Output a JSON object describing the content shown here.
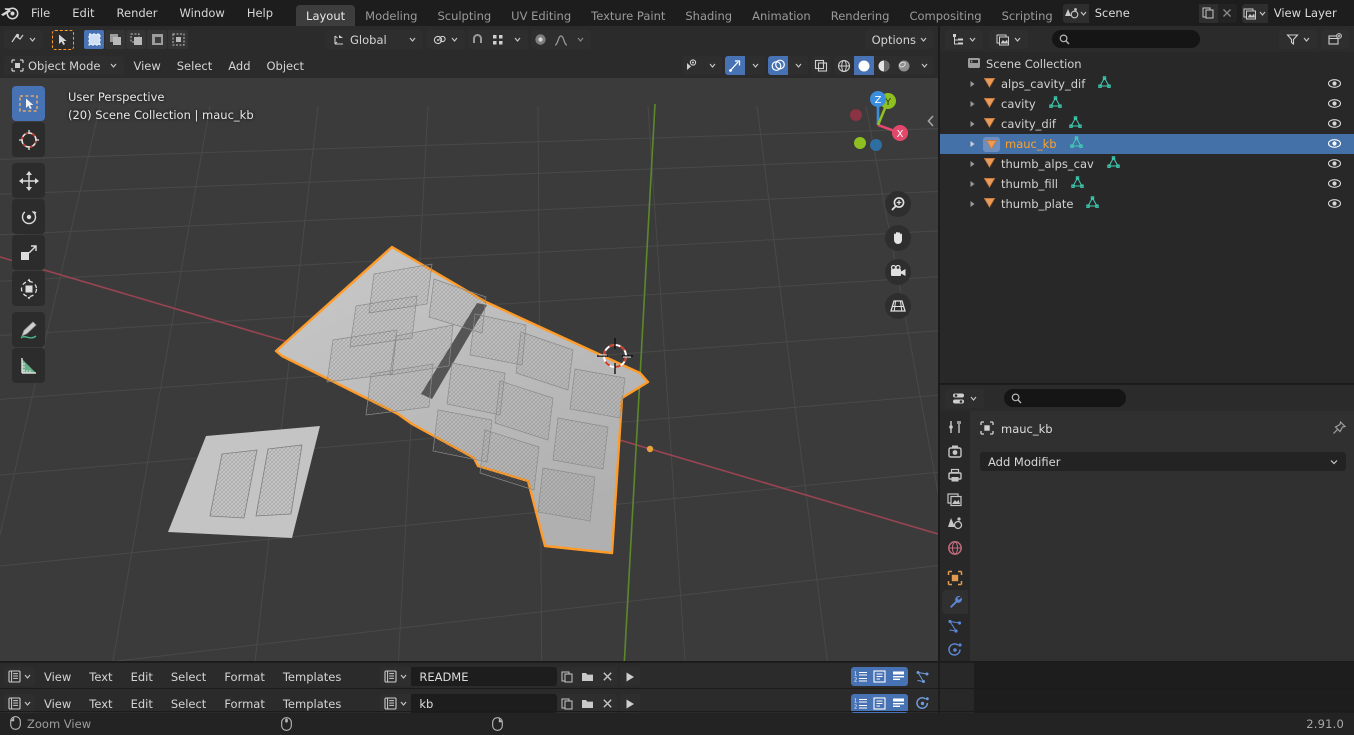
{
  "app": {
    "name": "Blender",
    "version": "2.91.0",
    "logo_icon": "blender-logo-icon"
  },
  "topbar": {
    "menus": [
      "File",
      "Edit",
      "Render",
      "Window",
      "Help"
    ],
    "workspace_tabs": [
      {
        "label": "Layout",
        "active": true
      },
      {
        "label": "Modeling",
        "active": false
      },
      {
        "label": "Sculpting",
        "active": false
      },
      {
        "label": "UV Editing",
        "active": false
      },
      {
        "label": "Texture Paint",
        "active": false
      },
      {
        "label": "Shading",
        "active": false
      },
      {
        "label": "Animation",
        "active": false
      },
      {
        "label": "Rendering",
        "active": false
      },
      {
        "label": "Compositing",
        "active": false
      },
      {
        "label": "Scripting",
        "active": false
      }
    ],
    "scene": {
      "label": "Scene",
      "icon": "scene-icon",
      "new_icon": "duplicate-icon",
      "unlink_icon": "close-x-icon"
    },
    "view_layer": {
      "label": "View Layer",
      "icon": "view-layer-icon",
      "new_icon": "duplicate-icon",
      "unlink_icon": "close-x-icon"
    }
  },
  "viewport": {
    "header": {
      "editor_type_icon": "editor-type-3dview-icon",
      "mode": "Object Mode",
      "mode_icon": "object-mode-icon",
      "menus": [
        "View",
        "Select",
        "Add",
        "Object"
      ],
      "select_modes": [
        "select-box-icon",
        "select-new-icon",
        "select-extend-icon",
        "select-subtract-icon",
        "select-invert-icon"
      ],
      "cursor_tool_icon": "cursor-tool-icon",
      "transform_orientation": "Global",
      "transform_orientation_icon": "orientation-global-icon",
      "pivot_icon": "pivot-point-icon",
      "snap_icon": "snap-magnet-icon",
      "snap_target_icon": "snap-target-icon",
      "proportional_icon": "proportional-editing-icon",
      "proportional_falloff_icon": "falloff-smooth-icon",
      "options_label": "Options",
      "visibility_icon": "visibility-eye-icon",
      "gizmo_icon": "gizmo-icon",
      "overlays_icon": "overlays-icon",
      "xray_icon": "xray-toggle-icon",
      "shading_modes": [
        {
          "icon": "shading-wireframe-icon",
          "active": false
        },
        {
          "icon": "shading-solid-icon",
          "active": true
        },
        {
          "icon": "shading-material-icon",
          "active": false
        },
        {
          "icon": "shading-rendered-icon",
          "active": false
        }
      ]
    },
    "overlay": {
      "perspective": "User Perspective",
      "context": "(20) Scene Collection | mauc_kb"
    },
    "toolbar": [
      {
        "name": "tweak-select-box-tool",
        "icon": "select-box-tool-icon",
        "active": true
      },
      {
        "name": "cursor-tool",
        "icon": "3d-cursor-tool-icon",
        "active": false
      },
      {
        "name": "move-tool",
        "icon": "move-tool-icon",
        "active": false
      },
      {
        "name": "rotate-tool",
        "icon": "rotate-tool-icon",
        "active": false
      },
      {
        "name": "scale-tool",
        "icon": "scale-tool-icon",
        "active": false
      },
      {
        "name": "transform-tool",
        "icon": "transform-tool-icon",
        "active": false
      },
      {
        "name": "annotate-tool",
        "icon": "annotate-tool-icon",
        "active": false
      },
      {
        "name": "measure-tool",
        "icon": "measure-tool-icon",
        "active": false
      }
    ],
    "gizmo": {
      "axes": [
        "X",
        "Y",
        "Z"
      ],
      "colors": {
        "x": "#e2486a",
        "y": "#8fc022",
        "z": "#3b8ede"
      }
    },
    "nav_buttons": [
      "zoom-icon",
      "pan-hand-icon",
      "camera-view-icon",
      "toggle-ortho-grid-icon"
    ],
    "sidebar_toggle_icon": "chevron-left-icon",
    "cursor_3d_icon": "3d-cursor-icon",
    "scene_objects": [
      {
        "name": "mauc_kb",
        "selected": true,
        "description": "split keyboard plate with key cutouts"
      },
      {
        "name": "thumb_plate",
        "selected": false,
        "description": "small two-key thumb cluster plate"
      }
    ]
  },
  "outliner": {
    "header": {
      "editor_type_icon": "editor-type-outliner-icon",
      "display_mode_icon": "outliner-view-layer-icon",
      "search_icon": "search-icon",
      "search_value": "",
      "filter_icon": "filter-funnel-icon",
      "new_collection_icon": "new-collection-icon"
    },
    "root": {
      "label": "Scene Collection",
      "icon": "collection-icon"
    },
    "items": [
      {
        "label": "alps_cavity_dif",
        "icon": "object-mesh-icon",
        "data_icon": "mesh-data-icon",
        "selected": false,
        "visible": true
      },
      {
        "label": "cavity",
        "icon": "object-mesh-icon",
        "data_icon": "mesh-data-icon",
        "selected": false,
        "visible": true
      },
      {
        "label": "cavity_dif",
        "icon": "object-mesh-icon",
        "data_icon": "mesh-data-icon",
        "selected": false,
        "visible": true
      },
      {
        "label": "mauc_kb",
        "icon": "object-mesh-icon",
        "data_icon": "mesh-data-icon",
        "selected": true,
        "visible": true
      },
      {
        "label": "thumb_alps_cav",
        "icon": "object-mesh-icon",
        "data_icon": "mesh-data-icon",
        "selected": false,
        "visible": true
      },
      {
        "label": "thumb_fill",
        "icon": "object-mesh-icon",
        "data_icon": "mesh-data-icon",
        "selected": false,
        "visible": true
      },
      {
        "label": "thumb_plate",
        "icon": "object-mesh-icon",
        "data_icon": "mesh-data-icon",
        "selected": false,
        "visible": true
      }
    ]
  },
  "properties": {
    "header": {
      "editor_type_icon": "editor-type-properties-icon",
      "search_icon": "search-icon",
      "search_value": ""
    },
    "tabs": [
      {
        "name": "tool",
        "icon": "tool-wrench-screwdriver-icon",
        "active": false
      },
      {
        "name": "render",
        "icon": "render-camera-icon",
        "active": false
      },
      {
        "name": "output",
        "icon": "output-printer-icon",
        "active": false
      },
      {
        "name": "view-layer",
        "icon": "view-layer-images-icon",
        "active": false
      },
      {
        "name": "scene",
        "icon": "scene-cone-icon",
        "active": false
      },
      {
        "name": "world",
        "icon": "world-globe-icon",
        "active": false
      },
      {
        "name": "object",
        "icon": "object-square-icon",
        "active": false
      },
      {
        "name": "modifier",
        "icon": "modifier-wrench-icon",
        "active": true
      },
      {
        "name": "particles",
        "icon": "particles-icon",
        "active": false
      },
      {
        "name": "physics",
        "icon": "physics-orbit-icon",
        "active": false
      }
    ],
    "breadcrumb": {
      "object_icon": "object-data-icon",
      "object_name": "mauc_kb",
      "pin_icon": "pin-icon"
    },
    "add_modifier": {
      "label": "Add Modifier",
      "chevron_icon": "chevron-down-icon"
    }
  },
  "text_editors": [
    {
      "editor_type_icon": "editor-type-text-icon",
      "menus": [
        "View",
        "Text",
        "Edit",
        "Select",
        "Format",
        "Templates"
      ],
      "datablock_icon": "text-datablock-icon",
      "filename": "README",
      "new_icon": "duplicate-icon",
      "open_icon": "folder-open-icon",
      "unlink_icon": "close-x-icon",
      "run_icon": "run-script-icon",
      "toggles": [
        "line-numbers-icon",
        "word-wrap-icon",
        "syntax-highlight-icon"
      ],
      "side_icon": "particles-icon"
    },
    {
      "editor_type_icon": "editor-type-text-icon",
      "menus": [
        "View",
        "Text",
        "Edit",
        "Select",
        "Format",
        "Templates"
      ],
      "datablock_icon": "text-datablock-icon",
      "filename": "kb",
      "new_icon": "duplicate-icon",
      "open_icon": "folder-open-icon",
      "unlink_icon": "close-x-icon",
      "run_icon": "run-script-icon",
      "toggles": [
        "line-numbers-icon",
        "word-wrap-icon",
        "syntax-highlight-icon"
      ],
      "side_icon": "physics-orbit-icon"
    }
  ],
  "statusbar": {
    "mouse_icon_left": "mouse-left-drag-icon",
    "hint": "Zoom View",
    "mouse_icon_middle": "mouse-middle-icon",
    "mouse_icon_right": "mouse-right-icon",
    "version": "2.91.0"
  },
  "colors": {
    "accent_blue": "#4772b3",
    "selected_orange": "#ffa028",
    "outliner_selected": "#4471a8",
    "mesh_icon_orange": "#ed9b5a",
    "mesh_data_green": "#3ecfb5",
    "axis_x_red": "#e2486a",
    "axis_y_green": "#8fc022",
    "axis_z_blue": "#3b8ede"
  }
}
